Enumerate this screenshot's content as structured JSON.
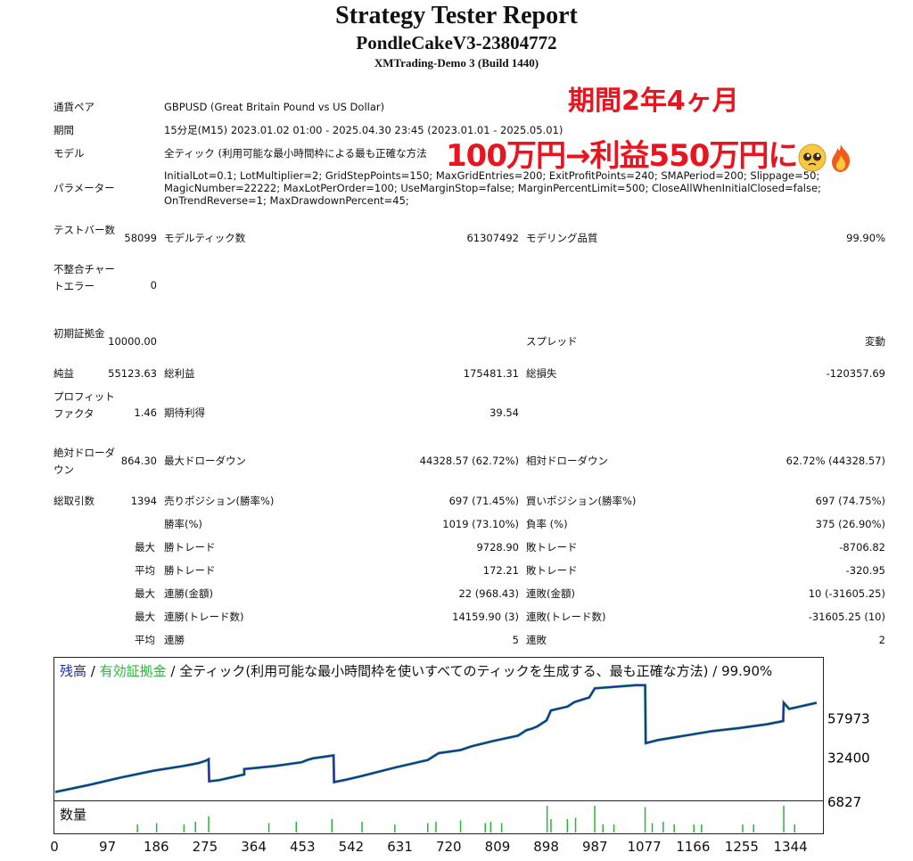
{
  "header": {
    "title": "Strategy Tester Report",
    "expert": "PondleCakeV3-23804772",
    "server": "XMTrading-Demo 3 (Build 1440)"
  },
  "overlay": {
    "period_note": "期間2年4ヶ月",
    "profit_note": "100万円→利益550万円に"
  },
  "settings": {
    "symbol_label": "通貨ペア",
    "symbol_value": "GBPUSD (Great Britain Pound vs US Dollar)",
    "period_label": "期間",
    "period_value": "15分足(M15) 2023.01.02 01:00 - 2025.04.30 23:45 (2023.01.01 - 2025.05.01)",
    "model_label": "モデル",
    "model_value": "全ティック (利用可能な最小時間枠による最も正確な方法",
    "params_label": "パラメーター",
    "params_value": "InitialLot=0.1; LotMultiplier=2; GridStepPoints=150; MaxGridEntries=200; ExitProfitPoints=240; SMAPeriod=200; Slippage=50; MagicNumber=22222; MaxLotPerOrder=100; UseMarginStop=false; MarginPercentLimit=500; CloseAllWhenInitialClosed=false; OnTrendReverse=1; MaxDrawdownPercent=45;"
  },
  "stats": {
    "bars_label": "テストバー数",
    "bars_value": "58099",
    "ticks_label": "モデルティック数",
    "ticks_value": "61307492",
    "quality_label": "モデリング品質",
    "quality_value": "99.90%",
    "mismatch_label": "不整合チャートエラー",
    "mismatch_value": "0",
    "deposit_label": "初期証拠金",
    "deposit_value": "10000.00",
    "spread_label": "スプレッド",
    "spread_value": "変動",
    "net_label": "純益",
    "net_value": "55123.63",
    "gross_profit_label": "総利益",
    "gross_profit_value": "175481.31",
    "gross_loss_label": "総損失",
    "gross_loss_value": "-120357.69",
    "pf_label": "プロフィットファクタ",
    "pf_value": "1.46",
    "expected_label": "期待利得",
    "expected_value": "39.54",
    "abs_dd_label": "絶対ドローダウン",
    "abs_dd_value": "864.30",
    "max_dd_label": "最大ドローダウン",
    "max_dd_value": "44328.57 (62.72%)",
    "rel_dd_label": "相対ドローダウン",
    "rel_dd_value": "62.72% (44328.57)",
    "trades_label": "総取引数",
    "trades_value": "1394",
    "short_label": "売りポジション(勝率%)",
    "short_value": "697 (71.45%)",
    "long_label": "買いポジション(勝率%)",
    "long_value": "697 (74.75%)",
    "win_label": "勝率(%)",
    "win_value": "1019 (73.10%)",
    "loss_label": "負率 (%)",
    "loss_value": "375 (26.90%)",
    "largest": "最大",
    "average": "平均",
    "largest_win_label": "勝トレード",
    "largest_win_value": "9728.90",
    "largest_loss_label": "敗トレード",
    "largest_loss_value": "-8706.82",
    "avg_win_label": "勝トレード",
    "avg_win_value": "172.21",
    "avg_loss_label": "敗トレード",
    "avg_loss_value": "-320.95",
    "max_cons_win_label": "連勝(金額)",
    "max_cons_win_value": "22 (968.43)",
    "max_cons_loss_label": "連敗(金額)",
    "max_cons_loss_value": "10 (-31605.25)",
    "max_cons_profit_label": "連勝(トレード数)",
    "max_cons_profit_value": "14159.90 (3)",
    "max_cons_lossamt_label": "連敗(トレード数)",
    "max_cons_lossamt_value": "-31605.25 (10)",
    "avg_cons_win_label": "連勝",
    "avg_cons_win_value": "5",
    "avg_cons_loss_label": "連敗",
    "avg_cons_loss_value": "2"
  },
  "chart_data": {
    "type": "line",
    "legend": {
      "balance": "残高",
      "sep1": " / ",
      "equity": "有効証拠金",
      "rest": " / 全ティック(利用可能な最小時間枠を使いすべてのティックを生成する、最も正確な方法) / 99.90%"
    },
    "balance_color": "#1a2fa8",
    "equity_color": "#2ab53a",
    "volume_color": "#2ab53a",
    "ylim": [
      6827,
      84000
    ],
    "y_ticks": [
      "57973",
      "32400",
      "6827"
    ],
    "x_ticks": [
      "0",
      "97",
      "186",
      "275",
      "364",
      "453",
      "542",
      "631",
      "720",
      "809",
      "898",
      "987",
      "1077",
      "1166",
      "1255",
      "1344"
    ],
    "volume_label": "数量",
    "series": [
      {
        "name": "残高",
        "x": [
          0,
          60,
          120,
          180,
          230,
          245,
          262,
          275,
          280,
          281,
          300,
          345,
          345,
          400,
          450,
          460,
          470,
          508,
          509,
          530,
          560,
          620,
          680,
          700,
          740,
          760,
          800,
          845,
          860,
          870,
          880,
          897,
          905,
          935,
          948,
          975,
          985,
          1060,
          1070,
          1075,
          1077,
          1078,
          1100,
          1150,
          1200,
          1250,
          1300,
          1329,
          1330,
          1340,
          1390
        ],
        "y": [
          10000,
          14500,
          19500,
          24000,
          26800,
          27800,
          29000,
          30500,
          31500,
          17000,
          17800,
          21500,
          25000,
          27000,
          29500,
          31000,
          32000,
          34000,
          16500,
          18000,
          20500,
          26000,
          31000,
          35500,
          37500,
          40000,
          43500,
          47000,
          50500,
          51500,
          53000,
          57000,
          63500,
          66000,
          69000,
          72000,
          78000,
          80000,
          80000,
          80000,
          80000,
          42000,
          44000,
          47000,
          50000,
          52000,
          54500,
          56500,
          68500,
          64500,
          68500
        ]
      }
    ],
    "volume": [
      {
        "x": 150,
        "v": 0.3
      },
      {
        "x": 185,
        "v": 0.35
      },
      {
        "x": 235,
        "v": 0.3
      },
      {
        "x": 256,
        "v": 0.4
      },
      {
        "x": 280,
        "v": 0.6
      },
      {
        "x": 390,
        "v": 0.35
      },
      {
        "x": 440,
        "v": 0.4
      },
      {
        "x": 505,
        "v": 0.5
      },
      {
        "x": 560,
        "v": 0.4
      },
      {
        "x": 620,
        "v": 0.3
      },
      {
        "x": 680,
        "v": 0.35
      },
      {
        "x": 695,
        "v": 0.4
      },
      {
        "x": 740,
        "v": 0.45
      },
      {
        "x": 785,
        "v": 0.35
      },
      {
        "x": 795,
        "v": 0.4
      },
      {
        "x": 815,
        "v": 0.35
      },
      {
        "x": 898,
        "v": 1.0
      },
      {
        "x": 905,
        "v": 0.5
      },
      {
        "x": 935,
        "v": 0.5
      },
      {
        "x": 950,
        "v": 0.55
      },
      {
        "x": 985,
        "v": 1.0
      },
      {
        "x": 1000,
        "v": 0.3
      },
      {
        "x": 1020,
        "v": 0.3
      },
      {
        "x": 1077,
        "v": 0.95
      },
      {
        "x": 1090,
        "v": 0.35
      },
      {
        "x": 1110,
        "v": 0.4
      },
      {
        "x": 1130,
        "v": 0.3
      },
      {
        "x": 1166,
        "v": 0.3
      },
      {
        "x": 1180,
        "v": 0.3
      },
      {
        "x": 1255,
        "v": 0.3
      },
      {
        "x": 1275,
        "v": 0.3
      },
      {
        "x": 1330,
        "v": 1.0
      },
      {
        "x": 1350,
        "v": 0.3
      }
    ]
  }
}
